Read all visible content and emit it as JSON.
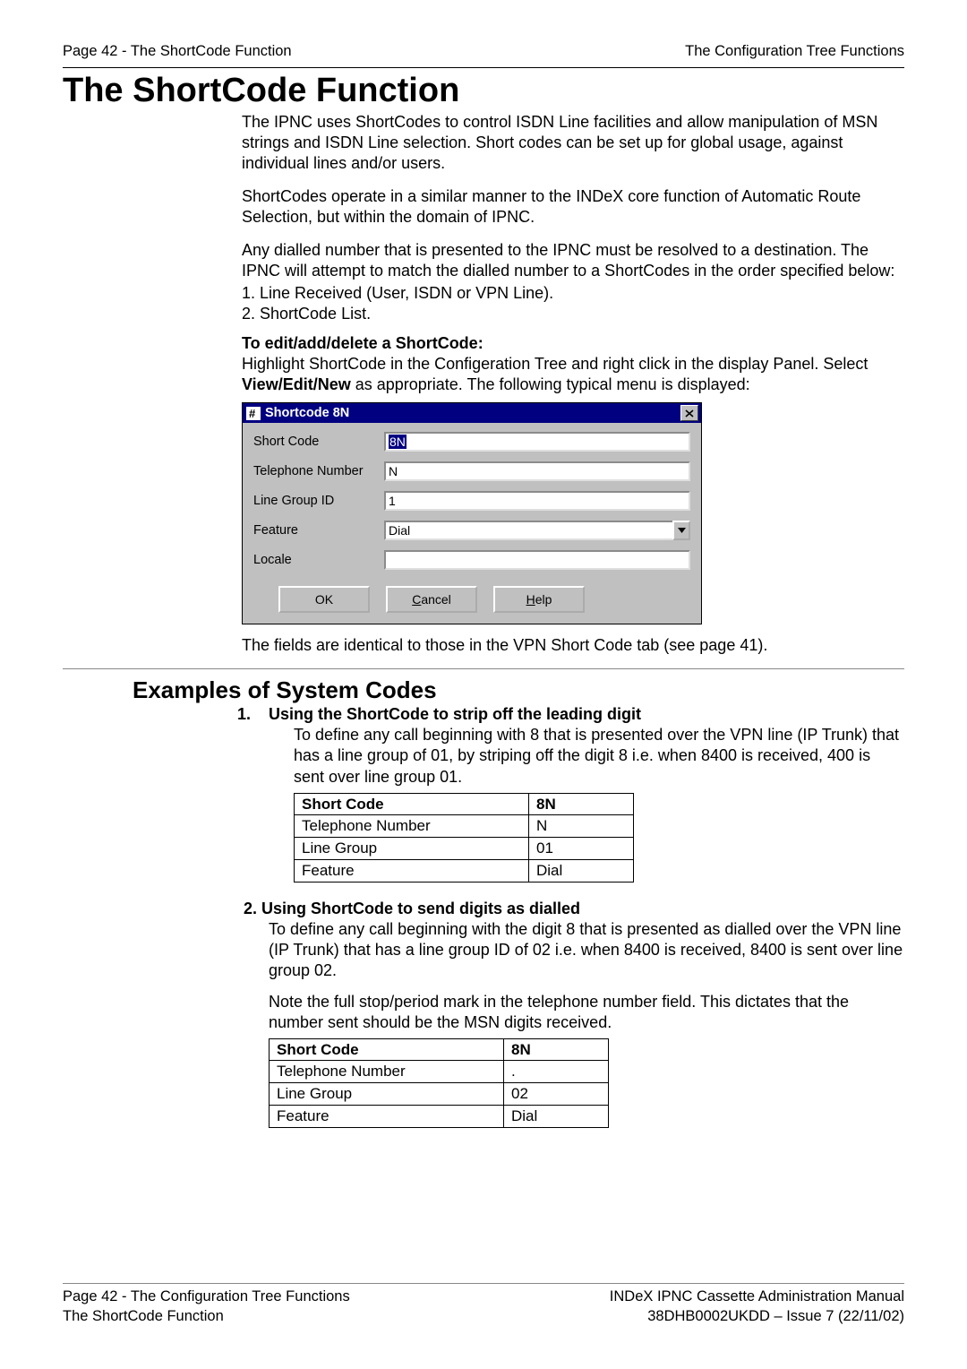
{
  "header": {
    "left": "Page 42 - The ShortCode Function",
    "right": "The Configuration Tree Functions"
  },
  "title": "The ShortCode Function",
  "para1": "The IPNC uses ShortCodes to control ISDN Line facilities and allow manipulation of MSN strings and ISDN Line selection. Short codes can be set up for global usage, against individual lines and/or users.",
  "para2": "ShortCodes operate in a similar manner to the INDeX core function of Automatic Route Selection, but within the domain of IPNC.",
  "para3": "Any dialled number that is presented to the IPNC must be resolved to a destination. The IPNC will attempt to match the dialled number to a ShortCodes in the order specified below:",
  "list1": "1. Line Received (User, ISDN or VPN Line).",
  "list2": "2. ShortCode List.",
  "heading_edit": "To edit/add/delete a ShortCode:",
  "edit_text_a": "Highlight ShortCode in the Configeration Tree and right click in the display Panel. Select ",
  "edit_text_bold": "View/Edit/New",
  "edit_text_b": " as appropriate. The following typical menu is displayed:",
  "dialog": {
    "title": "Shortcode 8N",
    "labels": {
      "shortcode": "Short Code",
      "telnum": "Telephone Number",
      "linegroup": "Line Group ID",
      "feature": "Feature",
      "locale": "Locale"
    },
    "values": {
      "shortcode": "8N",
      "telnum": "N",
      "linegroup": "1",
      "feature": "Dial",
      "locale": ""
    },
    "buttons": {
      "ok": "OK",
      "cancel_u": "C",
      "cancel_rest": "ancel",
      "help_u": "H",
      "help_rest": "elp"
    }
  },
  "after_dialog": "The fields are identical to those in the VPN Short Code tab (see page 41).",
  "subhead": "Examples of System Codes",
  "ex1": {
    "num": "1.",
    "title": "Using the ShortCode to strip off the leading digit",
    "body": "To define any call beginning with 8 that is presented over the VPN line (IP Trunk) that has a line group of 01, by striping off the digit 8 i.e. when 8400 is received, 400 is sent over line group 01.",
    "rows": [
      [
        "Short Code",
        "8N"
      ],
      [
        "Telephone Number",
        "N"
      ],
      [
        "Line Group",
        "01"
      ],
      [
        "Feature",
        "Dial"
      ]
    ]
  },
  "ex2": {
    "title": "2. Using ShortCode to send digits as dialled",
    "body1": "To define any call beginning with the digit 8 that is presented as dialled over the VPN line (IP Trunk) that has a line group ID of 02 i.e. when 8400 is received, 8400 is sent over line group 02.",
    "body2": "Note the full stop/period mark in the telephone number field. This dictates that the number sent should be the MSN digits received.",
    "rows": [
      [
        "Short Code",
        "8N"
      ],
      [
        "Telephone Number",
        "."
      ],
      [
        "Line Group",
        "02"
      ],
      [
        "Feature",
        "Dial"
      ]
    ]
  },
  "footer": {
    "left1": "Page 42 - The Configuration Tree Functions",
    "left2": "The ShortCode Function",
    "right1": "INDeX IPNC Cassette Administration Manual",
    "right2": "38DHB0002UKDD – Issue 7 (22/11/02)"
  }
}
